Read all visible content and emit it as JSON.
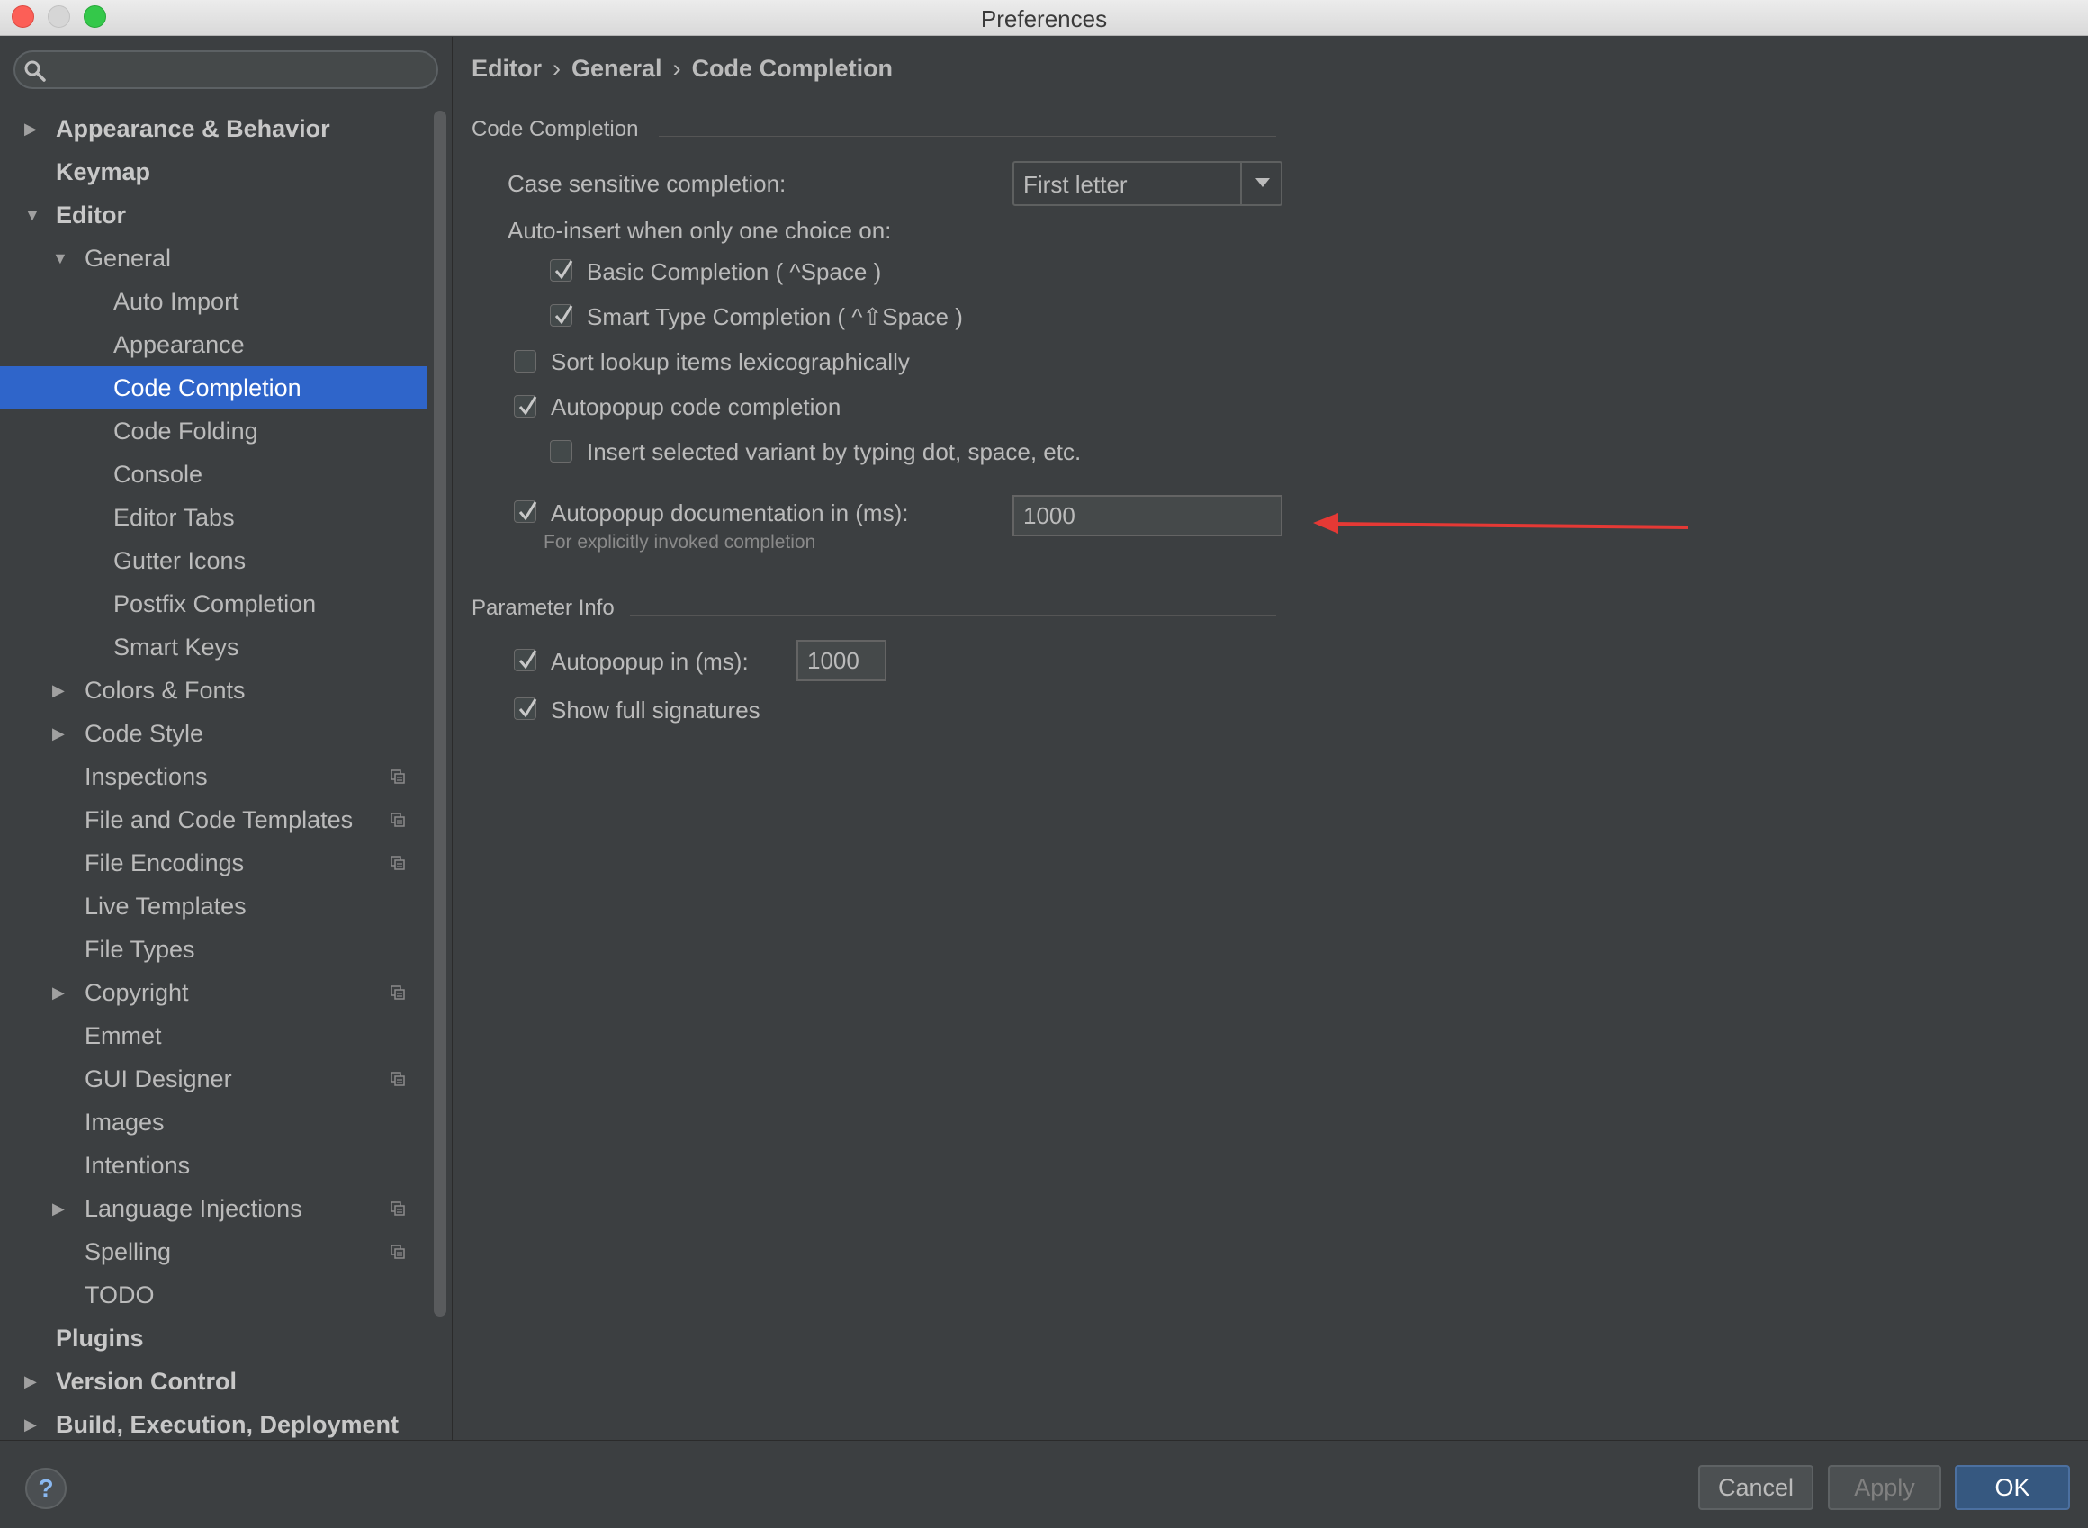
{
  "window": {
    "title": "Preferences"
  },
  "search": {
    "placeholder": "",
    "value": ""
  },
  "sidebar": {
    "items": [
      {
        "label": "Appearance & Behavior",
        "level": 0,
        "bold": true,
        "expander": "collapsed"
      },
      {
        "label": "Keymap",
        "level": 0,
        "bold": true,
        "expander": "none"
      },
      {
        "label": "Editor",
        "level": 0,
        "bold": true,
        "expander": "expanded"
      },
      {
        "label": "General",
        "level": 1,
        "bold": false,
        "expander": "expanded"
      },
      {
        "label": "Auto Import",
        "level": 2,
        "bold": false,
        "expander": "none"
      },
      {
        "label": "Appearance",
        "level": 2,
        "bold": false,
        "expander": "none"
      },
      {
        "label": "Code Completion",
        "level": 2,
        "bold": false,
        "expander": "none",
        "selected": true
      },
      {
        "label": "Code Folding",
        "level": 2,
        "bold": false,
        "expander": "none"
      },
      {
        "label": "Console",
        "level": 2,
        "bold": false,
        "expander": "none"
      },
      {
        "label": "Editor Tabs",
        "level": 2,
        "bold": false,
        "expander": "none"
      },
      {
        "label": "Gutter Icons",
        "level": 2,
        "bold": false,
        "expander": "none"
      },
      {
        "label": "Postfix Completion",
        "level": 2,
        "bold": false,
        "expander": "none"
      },
      {
        "label": "Smart Keys",
        "level": 2,
        "bold": false,
        "expander": "none"
      },
      {
        "label": "Colors & Fonts",
        "level": 1,
        "bold": false,
        "expander": "collapsed"
      },
      {
        "label": "Code Style",
        "level": 1,
        "bold": false,
        "expander": "collapsed"
      },
      {
        "label": "Inspections",
        "level": 1,
        "bold": false,
        "expander": "none",
        "project_icon": true
      },
      {
        "label": "File and Code Templates",
        "level": 1,
        "bold": false,
        "expander": "none",
        "project_icon": true
      },
      {
        "label": "File Encodings",
        "level": 1,
        "bold": false,
        "expander": "none",
        "project_icon": true
      },
      {
        "label": "Live Templates",
        "level": 1,
        "bold": false,
        "expander": "none"
      },
      {
        "label": "File Types",
        "level": 1,
        "bold": false,
        "expander": "none"
      },
      {
        "label": "Copyright",
        "level": 1,
        "bold": false,
        "expander": "collapsed",
        "project_icon": true
      },
      {
        "label": "Emmet",
        "level": 1,
        "bold": false,
        "expander": "none"
      },
      {
        "label": "GUI Designer",
        "level": 1,
        "bold": false,
        "expander": "none",
        "project_icon": true
      },
      {
        "label": "Images",
        "level": 1,
        "bold": false,
        "expander": "none"
      },
      {
        "label": "Intentions",
        "level": 1,
        "bold": false,
        "expander": "none"
      },
      {
        "label": "Language Injections",
        "level": 1,
        "bold": false,
        "expander": "collapsed",
        "project_icon": true
      },
      {
        "label": "Spelling",
        "level": 1,
        "bold": false,
        "expander": "none",
        "project_icon": true
      },
      {
        "label": "TODO",
        "level": 1,
        "bold": false,
        "expander": "none"
      },
      {
        "label": "Plugins",
        "level": 0,
        "bold": true,
        "expander": "none"
      },
      {
        "label": "Version Control",
        "level": 0,
        "bold": true,
        "expander": "collapsed"
      },
      {
        "label": "Build, Execution, Deployment",
        "level": 0,
        "bold": true,
        "expander": "collapsed"
      }
    ]
  },
  "breadcrumb": {
    "items": [
      "Editor",
      "General",
      "Code Completion"
    ],
    "separator": "›"
  },
  "code_completion": {
    "group_title": "Code Completion",
    "case_sensitive_label": "Case sensitive completion:",
    "case_sensitive_value": "First letter",
    "auto_insert_label": "Auto-insert when only one choice on:",
    "basic_completion": {
      "label": "Basic Completion ( ^Space )",
      "checked": true
    },
    "smart_type_completion": {
      "label": "Smart Type Completion ( ^⇧Space )",
      "checked": true
    },
    "sort_lookup": {
      "label": "Sort lookup items lexicographically",
      "checked": false
    },
    "autopopup_code": {
      "label": "Autopopup code completion",
      "checked": true
    },
    "insert_selected": {
      "label": "Insert selected variant by typing dot, space, etc.",
      "checked": false
    },
    "autopopup_doc": {
      "label": "Autopopup documentation in (ms):",
      "checked": true,
      "value": "1000",
      "hint": "For explicitly invoked completion"
    }
  },
  "parameter_info": {
    "group_title": "Parameter Info",
    "autopopup": {
      "label": "Autopopup in (ms):",
      "checked": true,
      "value": "1000"
    },
    "show_full_signatures": {
      "label": "Show full signatures",
      "checked": true
    }
  },
  "buttons": {
    "help": "?",
    "cancel": "Cancel",
    "apply": "Apply",
    "ok": "OK"
  },
  "colors": {
    "selection": "#2f65ca",
    "background": "#3c3f41",
    "annotation_arrow": "#e53935",
    "ok_button": "#365880"
  }
}
